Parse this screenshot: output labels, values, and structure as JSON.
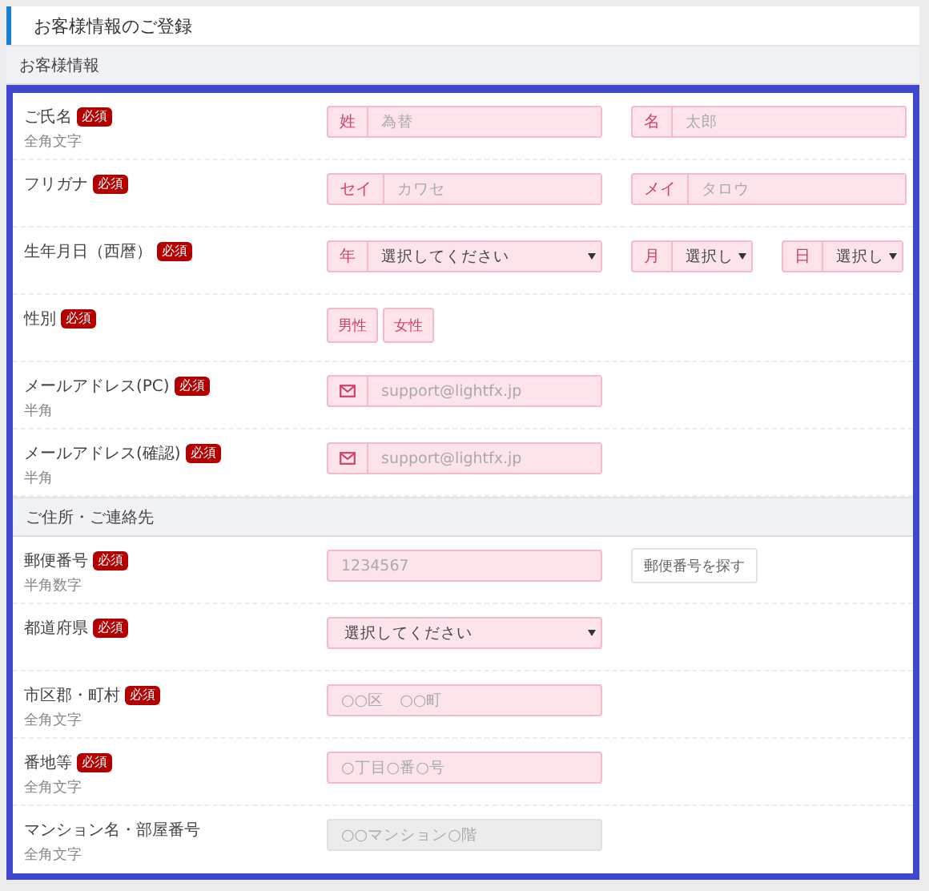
{
  "page_title": "お客様情報のご登録",
  "sections": [
    {
      "heading": "お客様情報",
      "rows": [
        {
          "label": "ご氏名",
          "badge": "必須",
          "note": "全角文字",
          "controls": [
            {
              "kind": "addon-input",
              "addon": "姓",
              "placeholder": "為替"
            },
            {
              "kind": "addon-input",
              "addon": "名",
              "placeholder": "太郎"
            }
          ]
        },
        {
          "label": "フリガナ",
          "badge": "必須",
          "controls": [
            {
              "kind": "addon-input",
              "addon": "セイ",
              "placeholder": "カワセ"
            },
            {
              "kind": "addon-input",
              "addon": "メイ",
              "placeholder": "タロウ"
            }
          ]
        },
        {
          "label": "生年月日（西暦）",
          "badge": "必須",
          "controls": [
            {
              "kind": "addon-select",
              "addon": "年",
              "value": "選択してください"
            },
            {
              "kind": "addon-select",
              "addon": "月",
              "value": "選択し"
            },
            {
              "kind": "addon-select",
              "addon": "日",
              "value": "選択し"
            }
          ]
        },
        {
          "label": "性別",
          "badge": "必須",
          "controls": [
            {
              "kind": "toggle-group",
              "options": [
                {
                  "label": "男性",
                  "selected": false
                },
                {
                  "label": "女性",
                  "selected": false
                }
              ]
            }
          ]
        },
        {
          "label": "メールアドレス(PC)",
          "badge": "必須",
          "note": "半角",
          "controls": [
            {
              "kind": "mail-input",
              "placeholder": "support@lightfx.jp"
            }
          ]
        },
        {
          "label": "メールアドレス(確認)",
          "badge": "必須",
          "note": "半角",
          "controls": [
            {
              "kind": "mail-input",
              "placeholder": "support@lightfx.jp"
            }
          ]
        }
      ]
    },
    {
      "heading": "ご住所・ご連絡先",
      "rows": [
        {
          "label": "郵便番号",
          "badge": "必須",
          "note": "半角数字",
          "controls": [
            {
              "kind": "input",
              "placeholder": "1234567",
              "disabled": false
            },
            {
              "kind": "button",
              "label": "郵便番号を探す"
            }
          ]
        },
        {
          "label": "都道府県",
          "badge": "必須",
          "controls": [
            {
              "kind": "select",
              "value": "選択してください"
            }
          ]
        },
        {
          "label": "市区郡・町村",
          "badge": "必須",
          "note": "全角文字",
          "controls": [
            {
              "kind": "input",
              "placeholder": "○○区　○○町",
              "disabled": false
            }
          ]
        },
        {
          "label": "番地等",
          "badge": "必須",
          "note": "全角文字",
          "controls": [
            {
              "kind": "input",
              "placeholder": "○丁目○番○号",
              "disabled": false
            }
          ]
        },
        {
          "label": "マンション名・部屋番号",
          "note": "全角文字",
          "controls": [
            {
              "kind": "input",
              "placeholder": "○○マンション○階",
              "disabled": true
            }
          ]
        }
      ]
    }
  ]
}
